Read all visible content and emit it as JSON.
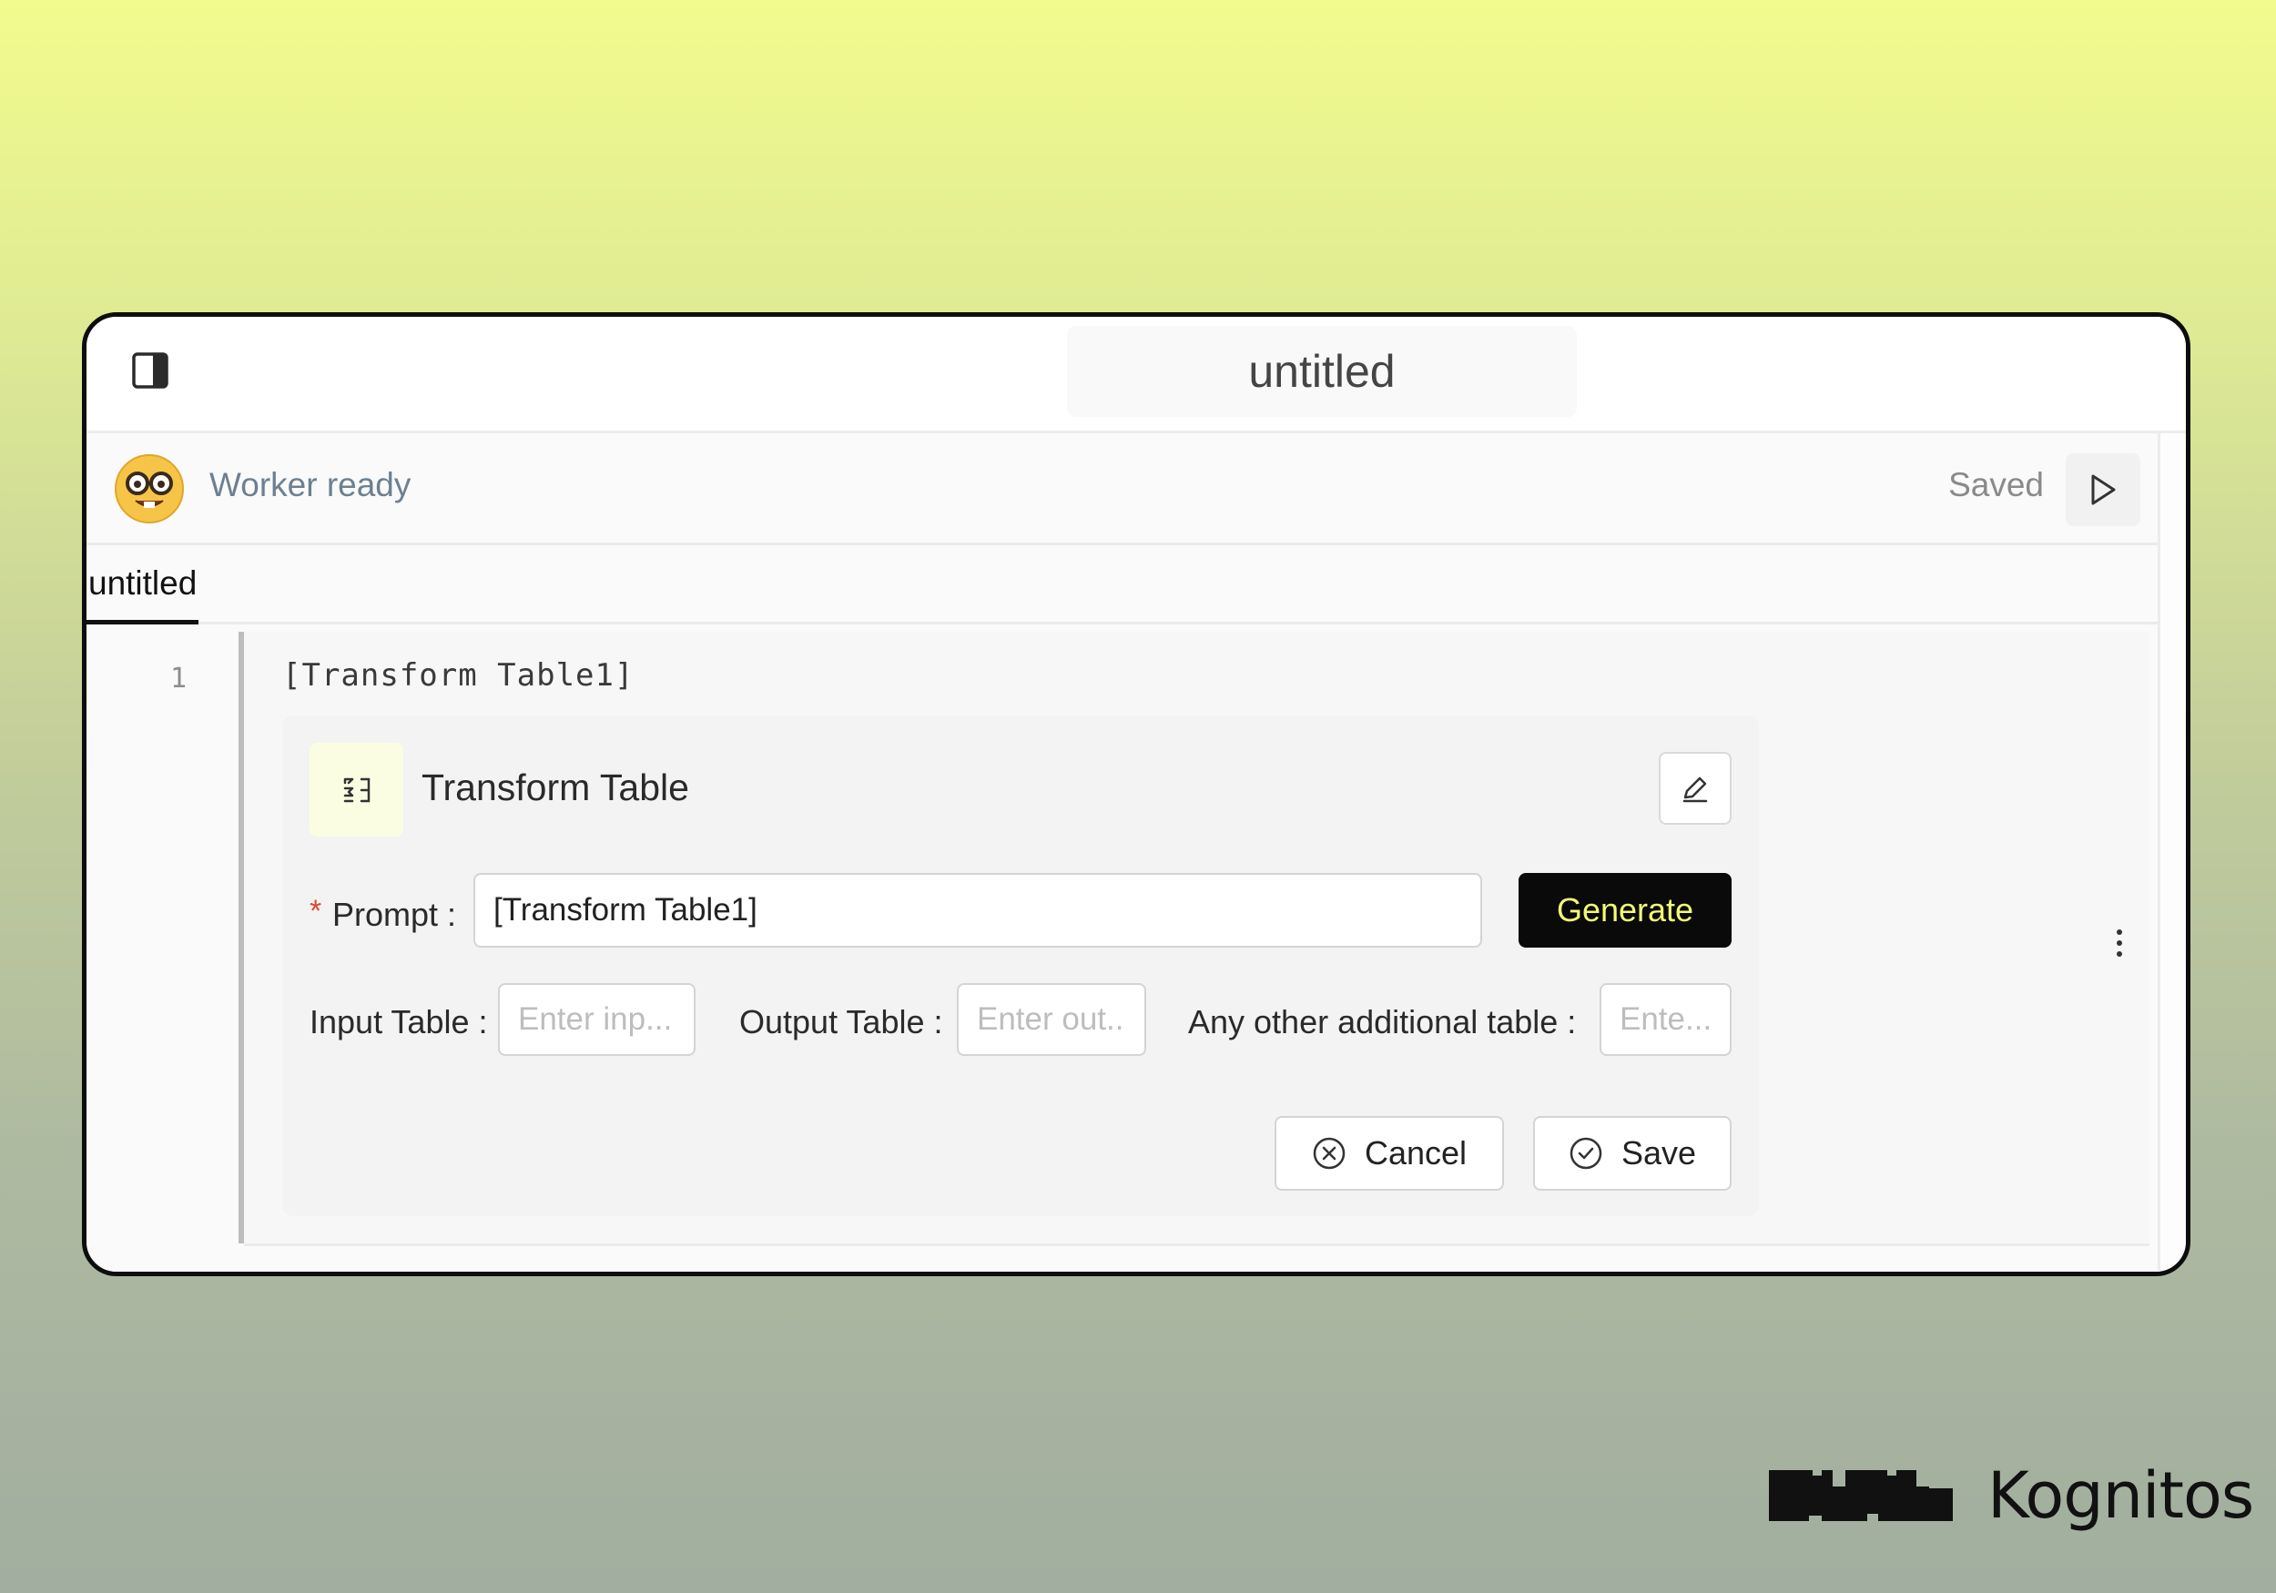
{
  "window": {
    "title": "untitled"
  },
  "status_bar": {
    "avatar_emoji": "🤓",
    "status_text": "Worker ready",
    "save_state": "Saved"
  },
  "tabs": [
    {
      "label": "untitled",
      "active": true
    }
  ],
  "editor": {
    "lines": [
      {
        "number": "1",
        "code": "[Transform Table1]"
      }
    ]
  },
  "card": {
    "title": "Transform Table",
    "prompt": {
      "required_marker": "*",
      "label": "Prompt :",
      "value": "[Transform Table1]"
    },
    "generate_label": "Generate",
    "input_table": {
      "label": "Input Table :",
      "placeholder": "Enter inp..."
    },
    "output_table": {
      "label": "Output Table :",
      "placeholder": "Enter out..."
    },
    "additional_table": {
      "label": "Any other additional table :",
      "placeholder": "Ente..."
    },
    "cancel_label": "Cancel",
    "save_label": "Save"
  },
  "brand": {
    "name": "Kognitos"
  },
  "colors": {
    "accent_yellow": "#f2fb73",
    "dark": "#0a0a0a",
    "status_text": "#6d8092",
    "required": "#e0452e"
  },
  "icons": {
    "sidebar_toggle": "sidebar-toggle-icon",
    "run": "play-icon",
    "card": "transform-icon",
    "edit": "pencil-icon",
    "cancel": "x-circle-icon",
    "save": "check-circle-icon",
    "more": "kebab-icon"
  }
}
